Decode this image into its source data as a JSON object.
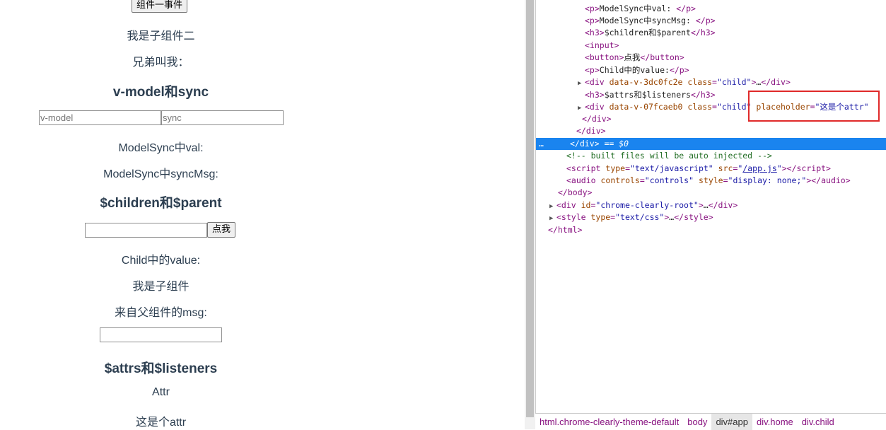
{
  "page": {
    "btn_event": "组件一事件",
    "child2": "我是子组件二",
    "brother": "兄弟叫我：",
    "h_vmodel": "v-model和sync",
    "ph_vmodel": "v-model",
    "ph_sync": "sync",
    "modelsync_val": "ModelSync中val:",
    "modelsync_syncmsg": "ModelSync中syncMsg:",
    "h_children": "$children和$parent",
    "btn_click": "点我",
    "child_value": "Child中的value:",
    "child_me": "我是子组件",
    "from_parent": "来自父组件的msg:",
    "h_attrs": "$attrs和$listeners",
    "attr": "Attr",
    "this_attr": "这是个attr"
  },
  "devtools": {
    "lines": [
      {
        "pre": "<",
        "tag": "p",
        "mid": ">ModelSync中val: </",
        "tag2": "p",
        "end": ">"
      },
      {
        "pre": "<",
        "tag": "p",
        "mid": ">ModelSync中syncMsg: </",
        "tag2": "p",
        "end": ">"
      },
      {
        "pre": "<",
        "tag": "h3",
        "mid": ">$children和$parent</",
        "tag2": "h3",
        "end": ">"
      },
      {
        "text": "<input>"
      },
      {
        "pre": "<",
        "tag": "button",
        "mid": ">点我</",
        "tag2": "button",
        "end": ">"
      },
      {
        "pre": "<",
        "tag": "p",
        "mid": ">Child中的value:</",
        "tag2": "p",
        "end": ">"
      }
    ],
    "div1_attr": "data-v-3dc0fc2e",
    "div1_class_name": "class",
    "div1_class_val": "\"child\"",
    "h3_attrs": "$attrs和$listeners",
    "div2_attr": "data-v-07fcaeb0",
    "div2_class_val": "\"child\"",
    "div2_ph_name": "placeholder",
    "div2_ph_val": "\"这是个attr\"",
    "selected_marker": "== $0",
    "comment": "<!-- built files will be auto injected -->",
    "script_type": "\"text/javascript\"",
    "script_src": "/app.js",
    "audio_controls": "\"controls\"",
    "audio_style": "\"display: none;\"",
    "div_id": "\"chrome-clearly-root\"",
    "style_type": "\"text/css\""
  },
  "breadcrumbs": [
    "html.chrome-clearly-theme-default",
    "body",
    "div#app",
    "div.home",
    "div.child"
  ],
  "colors": {
    "selected": "#1a84ef",
    "highlight_box": "#e02a2a",
    "tag": "#881280"
  }
}
